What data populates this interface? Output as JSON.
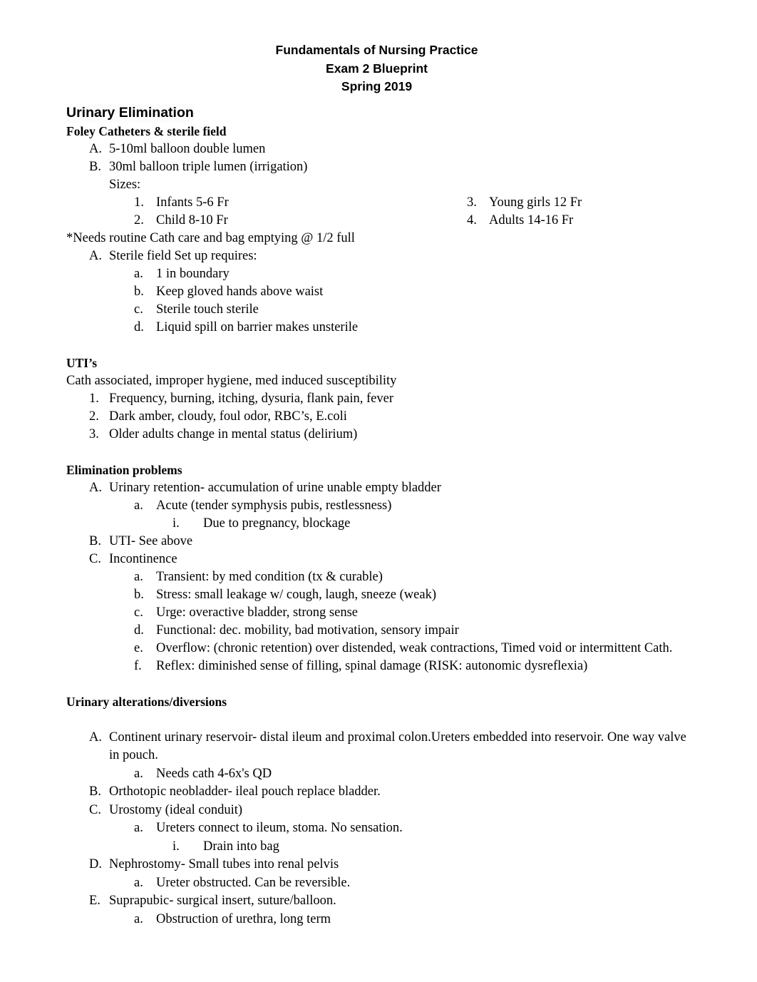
{
  "header": {
    "line1": "Fundamentals of Nursing Practice",
    "line2": "Exam 2 Blueprint",
    "line3": "Spring 2019"
  },
  "title": "Urinary Elimination",
  "sections": {
    "foley": {
      "heading": "Foley Catheters & sterile field",
      "items": [
        {
          "marker": "A.",
          "text": "5-10ml balloon double lumen"
        },
        {
          "marker": "B.",
          "text": "30ml balloon triple lumen (irrigation)"
        }
      ],
      "sizes_label": "Sizes:",
      "sizes_left": [
        {
          "marker": "1.",
          "text": "Infants 5-6 Fr"
        },
        {
          "marker": "2.",
          "text": "Child 8-10 Fr"
        }
      ],
      "sizes_right": [
        {
          "marker": "3.",
          "text": "Young girls 12 Fr"
        },
        {
          "marker": "4.",
          "text": "Adults 14-16 Fr"
        }
      ],
      "note": "*Needs routine Cath care and bag emptying @ 1/2 full",
      "sterile_field": {
        "marker": "A.",
        "text": "Sterile field Set up requires:"
      },
      "sterile_field_items": [
        {
          "marker": "a.",
          "text": "1 in boundary"
        },
        {
          "marker": "b.",
          "text": "Keep gloved hands above waist"
        },
        {
          "marker": "c.",
          "text": "Sterile touch sterile"
        },
        {
          "marker": "d.",
          "text": "Liquid spill on barrier makes unsterile"
        }
      ]
    },
    "uti": {
      "heading": "UTI’s",
      "intro": "Cath associated, improper hygiene, med induced susceptibility",
      "items": [
        {
          "marker": "1.",
          "text": "Frequency, burning, itching, dysuria, flank pain, fever"
        },
        {
          "marker": "2.",
          "text": "Dark amber, cloudy, foul odor, RBC’s, E.coli"
        },
        {
          "marker": "3.",
          "text": "Older adults change in mental status (delirium)"
        }
      ]
    },
    "elimination": {
      "heading": "Elimination problems",
      "retention": {
        "marker": "A.",
        "text": "Urinary retention- accumulation of urine unable empty bladder"
      },
      "retention_sub": {
        "marker": "a.",
        "text": "Acute (tender symphysis pubis, restlessness)"
      },
      "retention_sub_sub": {
        "marker": "i.",
        "text": "Due to pregnancy, blockage"
      },
      "uti_ref": {
        "marker": "B.",
        "text": "UTI- See above"
      },
      "incontinence": {
        "marker": "C.",
        "text": "Incontinence"
      },
      "incontinence_items": [
        {
          "marker": "a.",
          "text": "Transient: by med condition (tx & curable)"
        },
        {
          "marker": "b.",
          "text": "Stress: small leakage w/ cough, laugh, sneeze (weak)"
        },
        {
          "marker": "c.",
          "text": "Urge: overactive bladder, strong sense"
        },
        {
          "marker": "d.",
          "text": "Functional: dec. mobility, bad motivation, sensory impair"
        },
        {
          "marker": "e.",
          "text": "Overflow: (chronic retention) over distended, weak contractions, Timed void or intermittent Cath."
        },
        {
          "marker": "f.",
          "text": "Reflex: diminished sense of filling, spinal damage (RISK: autonomic dysreflexia)"
        }
      ]
    },
    "alterations": {
      "heading": "Urinary alterations/diversions",
      "continent": {
        "marker": "A.",
        "text": "Continent urinary reservoir- distal ileum and proximal colon.Ureters embedded into reservoir. One way valve in pouch."
      },
      "continent_sub": {
        "marker": "a.",
        "text": "Needs cath 4-6x's QD"
      },
      "neobladder": {
        "marker": "B.",
        "text": "Orthotopic neobladder- ileal pouch replace bladder."
      },
      "urostomy": {
        "marker": "C.",
        "text": "Urostomy (ideal conduit)"
      },
      "urostomy_sub": {
        "marker": "a.",
        "text": "Ureters connect to ileum, stoma. No sensation."
      },
      "urostomy_sub_sub": {
        "marker": "i.",
        "text": "Drain into bag"
      },
      "nephrostomy": {
        "marker": "D.",
        "text": "Nephrostomy- Small tubes into renal pelvis"
      },
      "nephrostomy_sub": {
        "marker": "a.",
        "text": "Ureter obstructed. Can be reversible."
      },
      "suprapubic": {
        "marker": "E.",
        "text": "Suprapubic- surgical insert, suture/balloon."
      },
      "suprapubic_sub": {
        "marker": "a.",
        "text": "Obstruction of urethra, long term"
      }
    }
  }
}
